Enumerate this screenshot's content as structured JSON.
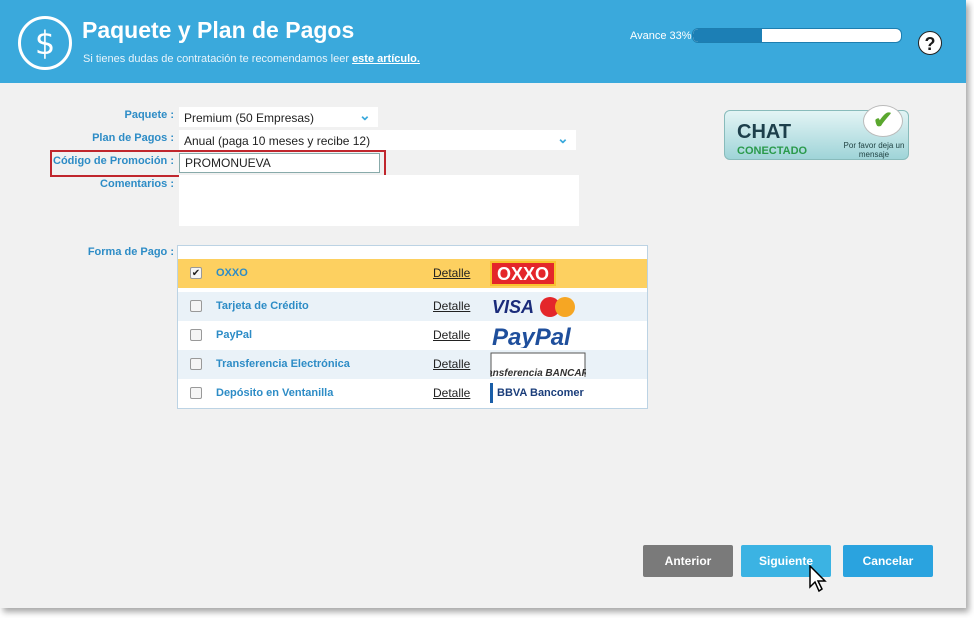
{
  "header": {
    "title": "Paquete y Plan de Pagos",
    "subtitle_prefix": "Si tienes dudas de contratación te recomendamos leer",
    "subtitle_link": "este artículo.",
    "progress_label": "Avance 33%",
    "progress_fraction": 0.33,
    "help_symbol": "?",
    "dollar_symbol": "$"
  },
  "form": {
    "paquete_label": "Paquete :",
    "paquete_value": "Premium (50 Empresas)",
    "plan_label": "Plan de Pagos :",
    "plan_value": "Anual (paga 10 meses y recibe 12)",
    "promo_label": "Código de Promoción :",
    "promo_value": "PROMONUEVA",
    "comentarios_label": "Comentarios :",
    "forma_pago_label": "Forma de Pago :"
  },
  "payment_methods": [
    {
      "name": "OXXO",
      "detail": "Detalle",
      "checked": true,
      "logo": "OXXO"
    },
    {
      "name": "Tarjeta de Crédito",
      "detail": "Detalle",
      "checked": false,
      "logo": "VISA"
    },
    {
      "name": "PayPal",
      "detail": "Detalle",
      "checked": false,
      "logo": "PayPal"
    },
    {
      "name": "Transferencia Electrónica",
      "detail": "Detalle",
      "checked": false,
      "logo": "Transferencia BANCARIA"
    },
    {
      "name": "Depósito en Ventanilla",
      "detail": "Detalle",
      "checked": false,
      "logo": "BBVA Bancomer"
    }
  ],
  "chat": {
    "title": "CHAT",
    "status": "CONECTADO",
    "note": "Por favor deja un mensaje"
  },
  "buttons": {
    "anterior": "Anterior",
    "siguiente": "Siguiente",
    "cancelar": "Cancelar"
  },
  "colors": {
    "header": "#3aa9dc",
    "selected_row": "#fdd060",
    "alt_row": "#eaf2f8",
    "anterior": "#7a7a7a",
    "siguiente": "#3bb3e3",
    "cancelar": "#2aa3df"
  }
}
